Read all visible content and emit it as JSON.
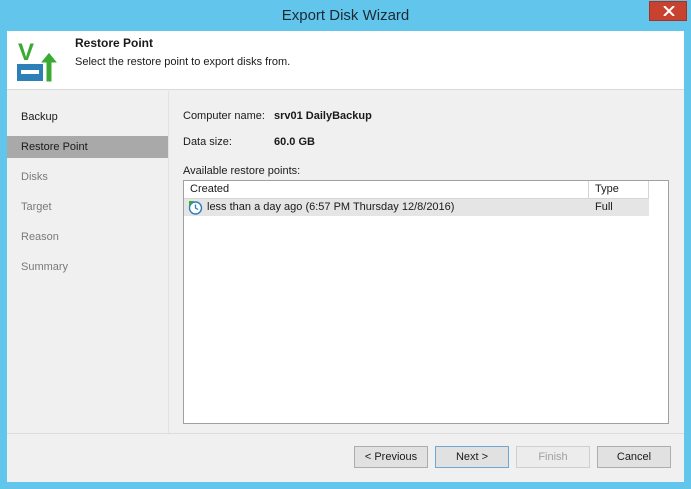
{
  "window": {
    "title": "Export Disk Wizard"
  },
  "header": {
    "title": "Restore Point",
    "subtitle": "Select the restore point to export disks from."
  },
  "sidebar": {
    "items": [
      {
        "label": "Backup",
        "state": "normal"
      },
      {
        "label": "Restore Point",
        "state": "active"
      },
      {
        "label": "Disks",
        "state": "disabled"
      },
      {
        "label": "Target",
        "state": "disabled"
      },
      {
        "label": "Reason",
        "state": "disabled"
      },
      {
        "label": "Summary",
        "state": "disabled"
      }
    ]
  },
  "content": {
    "computer_name_label": "Computer name:",
    "computer_name_value": "srv01 DailyBackup",
    "data_size_label": "Data size:",
    "data_size_value": "60.0 GB",
    "restore_points_label": "Available restore points:",
    "columns": {
      "created": "Created",
      "type": "Type"
    },
    "rows": [
      {
        "created": "less than a day ago (6:57 PM Thursday 12/8/2016)",
        "type": "Full",
        "icon": "restore-point-clock-icon"
      }
    ]
  },
  "footer": {
    "previous": "< Previous",
    "next": "Next >",
    "finish": "Finish",
    "cancel": "Cancel"
  },
  "colors": {
    "titlebar": "#62c6ec",
    "close": "#c7432f",
    "brand_green": "#3aaa35",
    "selected_nav": "#a9a9a9"
  }
}
